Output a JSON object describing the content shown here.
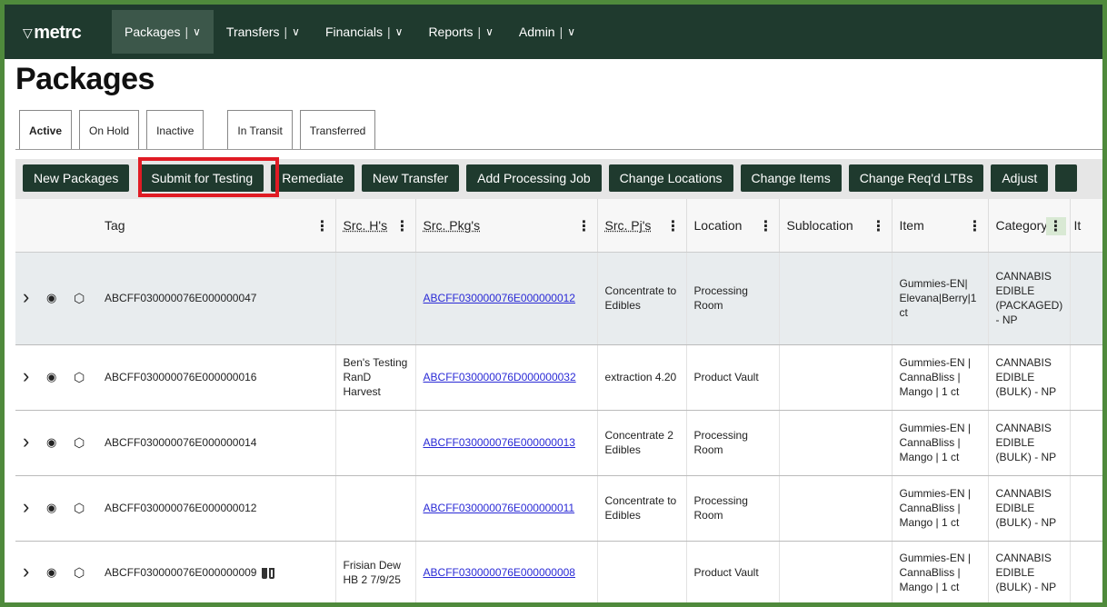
{
  "app": {
    "logo": "metrc",
    "logo_mark": "▽"
  },
  "nav": {
    "items": [
      {
        "label": "Packages",
        "active": true
      },
      {
        "label": "Transfers"
      },
      {
        "label": "Financials"
      },
      {
        "label": "Reports"
      },
      {
        "label": "Admin"
      }
    ],
    "sep": "|",
    "chevron": "∨"
  },
  "page": {
    "title": "Packages"
  },
  "tabs": [
    "Active",
    "On Hold",
    "Inactive",
    "In Transit",
    "Transferred"
  ],
  "toolbar": {
    "buttons": [
      "New Packages",
      "Submit for Testing",
      "Remediate",
      "New Transfer",
      "Add Processing Job",
      "Change Locations",
      "Change Items",
      "Change Req'd LTBs",
      "Adjust"
    ]
  },
  "table": {
    "headers": [
      "Tag",
      "Src. H's",
      "Src. Pkg's",
      "Src. Pj's",
      "Location",
      "Sublocation",
      "Item",
      "Category",
      "It"
    ],
    "rows": [
      {
        "tag": "ABCFF030000076E000000047",
        "src_h": "",
        "src_pkg": "ABCFF030000076E000000012",
        "src_pj": "Concentrate to Edibles",
        "location": "Processing Room",
        "sublocation": "",
        "item": "Gummies-EN| Elevana|Berry|1 ct",
        "category": "CANNABIS EDIBLE (PACKAGED) - NP"
      },
      {
        "tag": "ABCFF030000076E000000016",
        "src_h": "Ben's Testing RanD Harvest",
        "src_pkg": "ABCFF030000076D000000032",
        "src_pj": "extraction 4.20",
        "location": "Product Vault",
        "sublocation": "",
        "item": "Gummies-EN | CannaBliss | Mango | 1 ct",
        "category": "CANNABIS EDIBLE (BULK) - NP"
      },
      {
        "tag": "ABCFF030000076E000000014",
        "src_h": "",
        "src_pkg": "ABCFF030000076E000000013",
        "src_pj": "Concentrate 2 Edibles",
        "location": "Processing Room",
        "sublocation": "",
        "item": "Gummies-EN | CannaBliss | Mango | 1 ct",
        "category": "CANNABIS EDIBLE (BULK) - NP"
      },
      {
        "tag": "ABCFF030000076E000000012",
        "src_h": "",
        "src_pkg": "ABCFF030000076E000000011",
        "src_pj": "Concentrate to Edibles",
        "location": "Processing Room",
        "sublocation": "",
        "item": "Gummies-EN | CannaBliss | Mango | 1 ct",
        "category": "CANNABIS EDIBLE (BULK) - NP"
      },
      {
        "tag": "ABCFF030000076E000000009",
        "src_h": "Frisian Dew HB 2 7/9/25",
        "src_pkg": "ABCFF030000076E000000008",
        "src_pj": "",
        "location": "Product Vault",
        "sublocation": "",
        "item": "Gummies-EN | CannaBliss | Mango | 1 ct",
        "category": "CANNABIS EDIBLE (BULK) - NP"
      }
    ],
    "icons": {
      "expand": "chevron-right-icon",
      "view": "eye-icon",
      "package": "box-icon",
      "test": "test-tube-icon"
    }
  },
  "colors": {
    "header": "#1f3a2e",
    "border": "#4f8a3c",
    "highlight": "#e01b24",
    "link": "#2a2ad6"
  }
}
